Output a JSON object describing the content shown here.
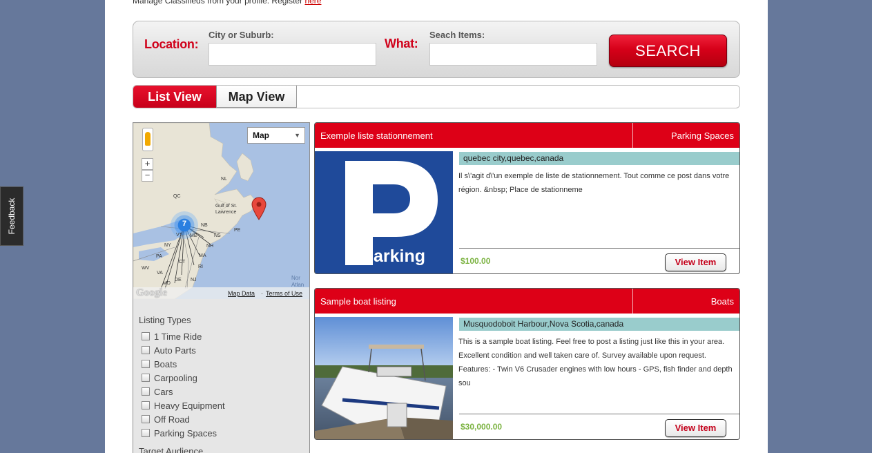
{
  "header": {
    "register_text": "Manage Classifieds from your profile. Register",
    "register_link": "here"
  },
  "search": {
    "location_label": "Location:",
    "city_label": "City or Suburb:",
    "city_value": "",
    "what_label": "What:",
    "items_label": "Seach Items:",
    "items_value": "",
    "button_label": "SEARCH"
  },
  "tabs": [
    {
      "label": "List View",
      "active": true
    },
    {
      "label": "Map View",
      "active": false
    }
  ],
  "map": {
    "type_label": "Map",
    "zoom_in": "+",
    "zoom_out": "−",
    "cluster_count": "7",
    "google_logo": "Google",
    "map_data_link": "Map Data",
    "terms_link": "Terms of Use",
    "labels": [
      "NL",
      "QC",
      "Gulf of St. Lawrence",
      "PE",
      "NB",
      "NS",
      "ME",
      "NH",
      "VT",
      "NY",
      "MA",
      "CT",
      "RI",
      "PA",
      "NJ",
      "WV",
      "VA",
      "DE",
      "MD",
      "Nor Atlan"
    ]
  },
  "filters": {
    "title": "Listing Types",
    "items": [
      "1 Time Ride",
      "Auto Parts",
      "Boats",
      "Carpooling",
      "Cars",
      "Heavy Equipment",
      "Off Road",
      "Parking Spaces"
    ],
    "next_title": "Target Audience"
  },
  "listings": [
    {
      "title": "Exemple liste stationnement",
      "category": "Parking Spaces",
      "location": "quebec city,quebec,canada",
      "description": "Il s\\'agit d\\'un exemple de liste de stationnement. Tout comme ce post dans votre région. &nbsp; Place de stationneme",
      "price": "$100.00",
      "button": "View Item",
      "image_label": "arking"
    },
    {
      "title": "Sample boat listing",
      "category": "Boats",
      "location": "Musquodoboit Harbour,Nova Scotia,canada",
      "description": "This is a sample boat listing. Feel free to post a listing just like this in your area. Excellent condition and well taken care of. Survey available upon request. Features: - Twin V6 Crusader engines with low hours - GPS, fish finder and depth sou",
      "price": "$30,000.00",
      "button": "View Item"
    }
  ],
  "feedback": {
    "label": "Feedback"
  },
  "colors": {
    "accent": "#dd0017",
    "background": "#66789b",
    "location_bar": "#99cccc",
    "price": "#7cb342"
  }
}
